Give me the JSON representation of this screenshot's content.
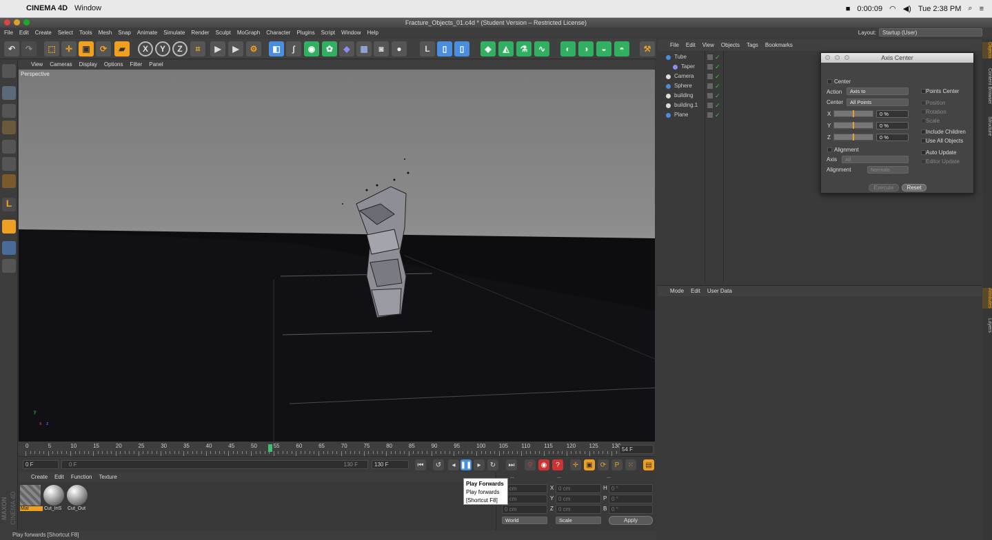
{
  "mac_menubar": {
    "app": "CINEMA 4D",
    "menu": "Window",
    "timer": "0:00:09",
    "clock": "Tue 2:38 PM"
  },
  "window_title": "Fracture_Objects_01.c4d * (Student Version – Restricted License)",
  "main_menu": [
    "File",
    "Edit",
    "Create",
    "Select",
    "Tools",
    "Mesh",
    "Snap",
    "Animate",
    "Simulate",
    "Render",
    "Sculpt",
    "MoGraph",
    "Character",
    "Plugins",
    "Script",
    "Window",
    "Help"
  ],
  "layout": {
    "label": "Layout:",
    "value": "Startup (User)"
  },
  "toolbar": {
    "x_label": "X",
    "y_label": "Y",
    "z_label": "Z"
  },
  "viewport": {
    "menu": [
      "View",
      "Cameras",
      "Display",
      "Options",
      "Filter",
      "Panel"
    ],
    "label": "Perspective",
    "axis_y": "y",
    "axis_x": "x",
    "axis_z": "z"
  },
  "timeline": {
    "ticks": [
      "0",
      "5",
      "10",
      "15",
      "20",
      "25",
      "30",
      "35",
      "40",
      "45",
      "50",
      "55",
      "60",
      "65",
      "70",
      "75",
      "80",
      "85",
      "90",
      "95",
      "100",
      "105",
      "110",
      "115",
      "120",
      "125",
      "130"
    ],
    "current_frame": "54 F",
    "start_field": "0 F",
    "slider_start": "0 F",
    "slider_end": "130 F",
    "end_field": "130 F"
  },
  "material_menu": [
    "Create",
    "Edit",
    "Function",
    "Texture"
  ],
  "materials": [
    {
      "name": "Mat"
    },
    {
      "name": "Cut_InS"
    },
    {
      "name": "Cut_Out"
    }
  ],
  "brand": {
    "maxon": "MAXON",
    "product": "CINEMA 4D"
  },
  "coords": {
    "header_a": "--",
    "header_b": "--",
    "header_c": "--",
    "rows": [
      {
        "a": "0 cm",
        "l2": "X",
        "b": "0 cm",
        "l3": "H",
        "c": "0 °"
      },
      {
        "a": "0 cm",
        "l2": "Y",
        "b": "0 cm",
        "l3": "P",
        "c": "0 °"
      },
      {
        "a": "0 cm",
        "l2": "Z",
        "b": "0 cm",
        "l3": "B",
        "c": "0 °"
      }
    ],
    "world": "World",
    "scale": "Scale",
    "apply": "Apply"
  },
  "tooltip": {
    "title": "Play Forwards",
    "line1": "Play forwards",
    "line2": "[Shortcut F8]"
  },
  "status": "Play forwards [Shortcut F8]",
  "object_menu": [
    "File",
    "Edit",
    "View",
    "Objects",
    "Tags",
    "Bookmarks"
  ],
  "objects": [
    {
      "name": "Tube"
    },
    {
      "name": "Taper"
    },
    {
      "name": "Camera"
    },
    {
      "name": "Sphere"
    },
    {
      "name": "building"
    },
    {
      "name": "building.1"
    },
    {
      "name": "Plane"
    }
  ],
  "attr_menu": [
    "Mode",
    "Edit",
    "User Data"
  ],
  "side_tabs": [
    "Objects",
    "Content Browser",
    "Structure",
    "Attributes",
    "Layers"
  ],
  "axis_dialog": {
    "title": "Axis Center",
    "center_section": "Center",
    "action_label": "Action",
    "action_value": "Axis to",
    "center_label": "Center",
    "center_value": "All Points",
    "x": "X",
    "y": "Y",
    "z": "Z",
    "xv": "0 %",
    "yv": "0 %",
    "zv": "0 %",
    "points_center": "Points Center",
    "position": "Position",
    "rotation": "Rotation",
    "scale": "Scale",
    "include_children": "Include Children",
    "use_all_objects": "Use All Objects",
    "alignment_check": "Alignment",
    "axis_label": "Axis",
    "axis_value": "All",
    "alignment_label": "Alignment",
    "alignment_value": "Normals",
    "auto_update": "Auto Update",
    "editor_update": "Editor Update",
    "execute": "Execute",
    "reset": "Reset"
  },
  "colors": {
    "accent": "#f0a020",
    "blue": "#4a8ee0",
    "green": "#30b060",
    "playhead": "#3fbf6f"
  }
}
